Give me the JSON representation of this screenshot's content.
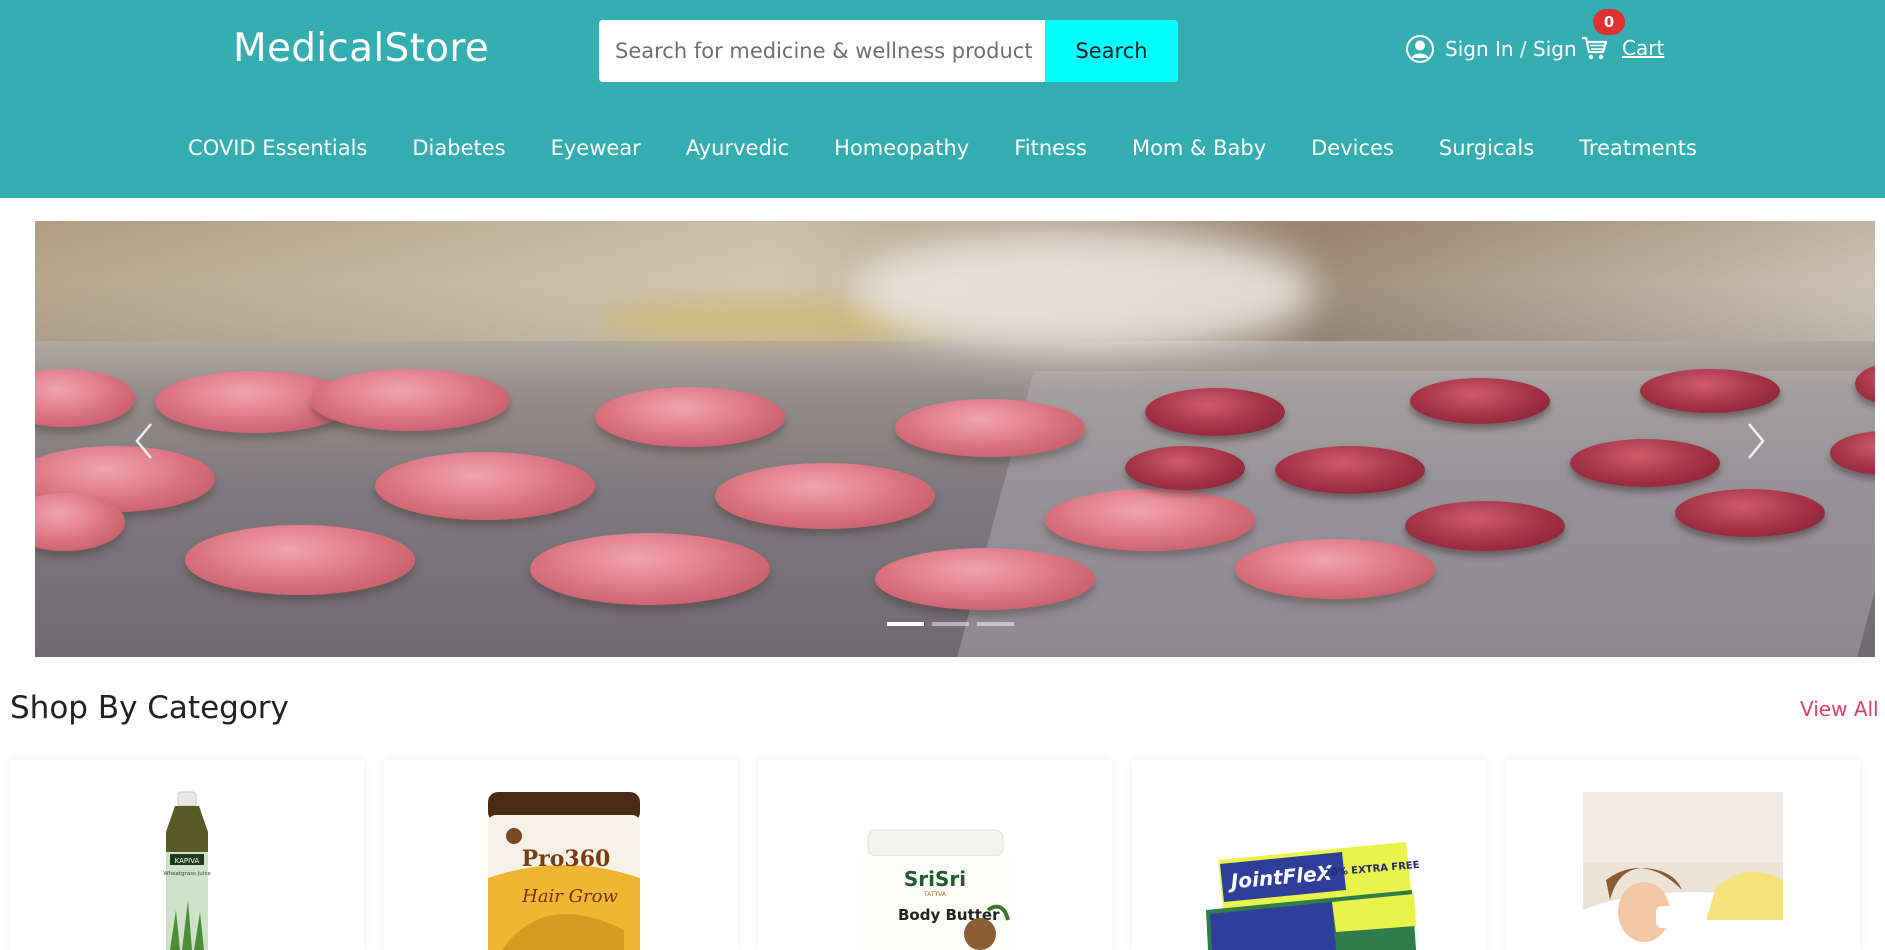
{
  "header": {
    "logo": "MedicalStore",
    "search": {
      "placeholder": "Search for medicine & wellness product",
      "button_label": "Search"
    },
    "signin_label": "Sign In / Sign",
    "cart": {
      "label": "Cart",
      "count": "0"
    },
    "colors": {
      "bar": "#35aeb2",
      "search_button": "#00ffff",
      "badge": "#e02f2f"
    }
  },
  "nav": {
    "items": [
      {
        "label": "COVID Essentials"
      },
      {
        "label": "Diabetes"
      },
      {
        "label": "Eyewear"
      },
      {
        "label": "Ayurvedic"
      },
      {
        "label": "Homeopathy"
      },
      {
        "label": "Fitness"
      },
      {
        "label": "Mom & Baby"
      },
      {
        "label": "Devices"
      },
      {
        "label": "Surgicals"
      },
      {
        "label": "Treatments"
      }
    ]
  },
  "carousel": {
    "slides": 3,
    "active_slide": 1
  },
  "category_section": {
    "title": "Shop By Category",
    "view_all": "View All",
    "accent": "#e43b69",
    "cards": [
      {
        "label": "KAPIVA",
        "sub": "Wheatgrass Juice",
        "icon": "juice-bottle-product"
      },
      {
        "label": "Pro360",
        "sub": "Hair Grow",
        "icon": "protein-jar-product"
      },
      {
        "label": "SriSri",
        "sub": "Body Butter",
        "sub2": "TATTVA",
        "icon": "body-butter-product"
      },
      {
        "label": "JointFleX",
        "sub": "20% EXTRA FREE",
        "icon": "cream-tube-product"
      },
      {
        "icon": "sick-woman-photo"
      }
    ]
  }
}
